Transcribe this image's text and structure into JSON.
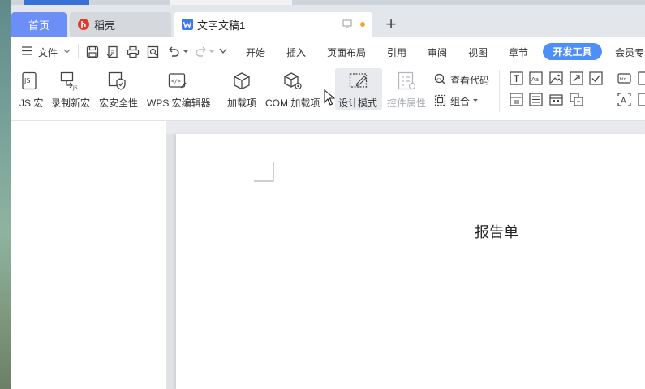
{
  "tabs": {
    "home": "首页",
    "docer": "稻壳",
    "doc_title": "文字文稿1",
    "add": "+"
  },
  "menu": {
    "file": "文件",
    "items": [
      "开始",
      "插入",
      "页面布局",
      "引用",
      "审阅",
      "视图",
      "章节",
      "开发工具",
      "会员专"
    ]
  },
  "ribbon": {
    "js_macro": "JS 宏",
    "record_macro": "录制新宏",
    "macro_security": "宏安全性",
    "wps_macro_editor": "WPS 宏编辑器",
    "addins": "加载项",
    "com_addins": "COM 加载项",
    "design_mode": "设计模式",
    "control_props": "控件属性",
    "view_code": "查看代码",
    "group": "组合"
  },
  "document": {
    "heading": "报告单"
  },
  "colors": {
    "accent": "#6b8ff6",
    "active_menu": "#4d8ef7",
    "tab_bar": "#e3e6ea"
  }
}
